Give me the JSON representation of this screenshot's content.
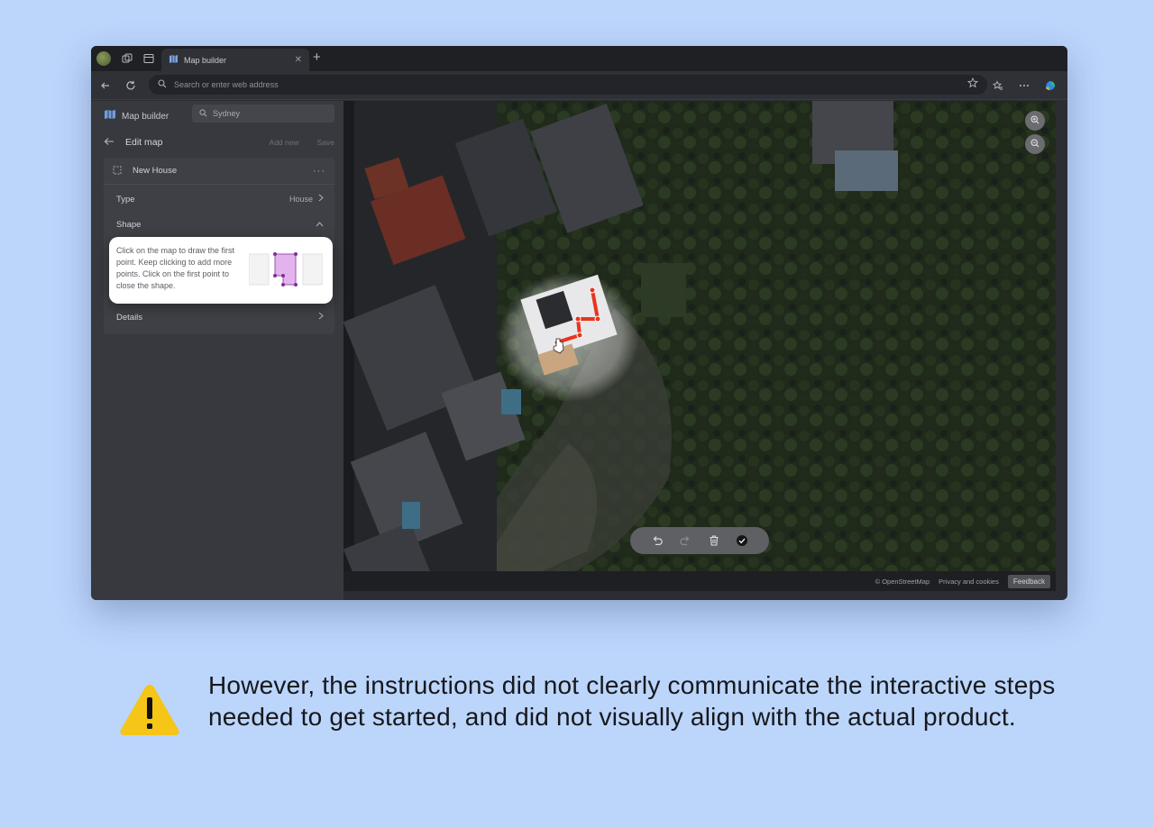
{
  "browser": {
    "tab_title": "Map builder",
    "tab_close": "✕",
    "new_tab": "+",
    "address_placeholder": "Search or enter web address"
  },
  "app": {
    "title": "Map builder",
    "search_value": "Sydney"
  },
  "edit": {
    "title": "Edit map",
    "add_new": "Add new",
    "save": "Save"
  },
  "item": {
    "name": "New House",
    "more": "···",
    "type_label": "Type",
    "type_value": "House",
    "shape_label": "Shape",
    "details_label": "Details"
  },
  "popup": {
    "instructions": "Click on the map to draw the first point. Keep clicking to add more points. Click on the first point to close the shape."
  },
  "map": {
    "footer_osm": "© OpenStreetMap",
    "footer_privacy": "Privacy and cookies",
    "feedback": "Feedback"
  },
  "caption": {
    "text": "However, the instructions did not clearly communicate the interactive steps needed to get started, and did not visually align with the actual product."
  },
  "colors": {
    "background": "#bcd5fb",
    "warning": "#f5c518",
    "draw_line": "#e8341c",
    "shape_fill": "#e3b3ee"
  },
  "icons": [
    "profile-avatar",
    "collections-icon",
    "tab-actions-icon",
    "map-icon",
    "back-icon",
    "refresh-icon",
    "search-icon",
    "favorite-add-icon",
    "favorites-icon",
    "more-icon",
    "copilot-icon",
    "back-arrow-icon",
    "selection-icon",
    "chevron-right-icon",
    "chevron-up-icon",
    "zoom-in-icon",
    "zoom-out-icon",
    "undo-icon",
    "redo-icon",
    "trash-icon",
    "check-icon",
    "warning-icon"
  ]
}
